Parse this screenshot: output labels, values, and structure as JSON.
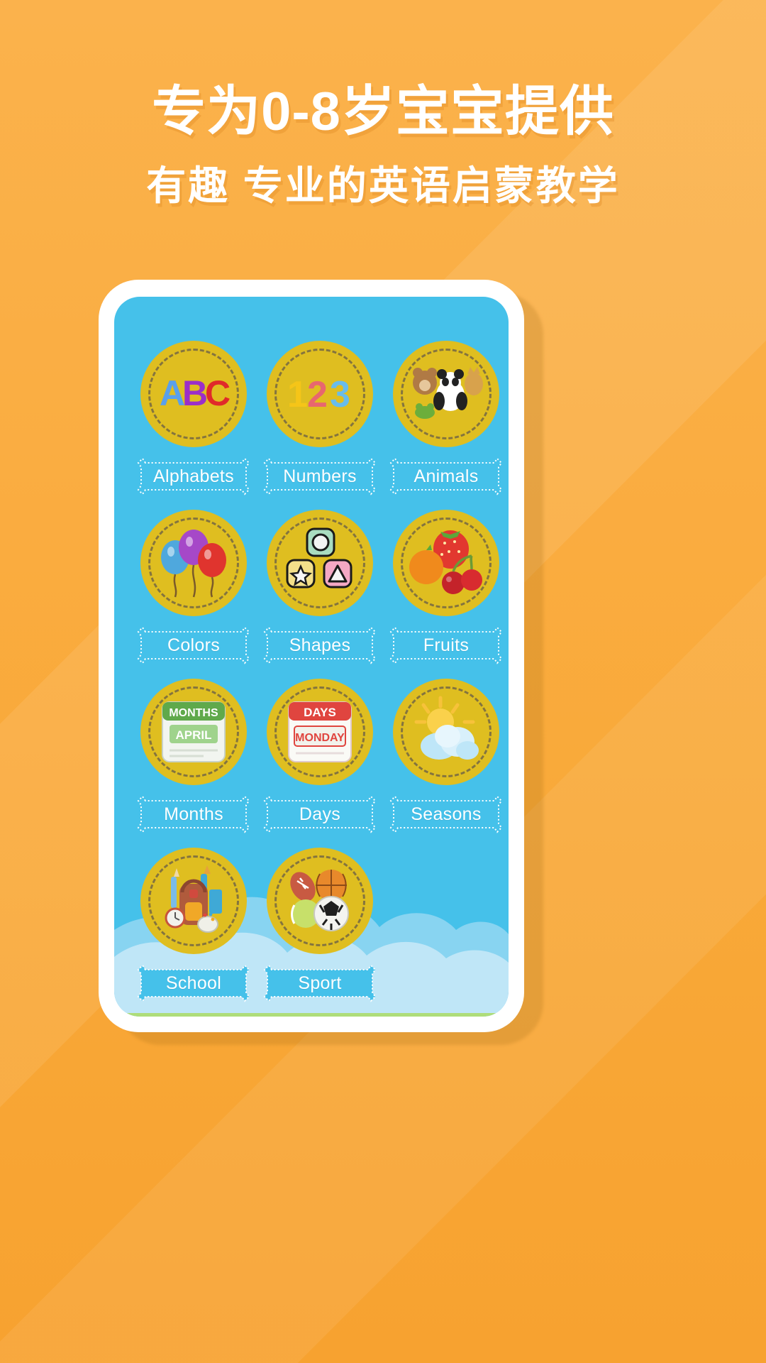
{
  "header": {
    "headline_main": "专为0-8岁宝宝提供",
    "headline_sub": "有趣  专业的英语启蒙教学"
  },
  "colors": {
    "background_orange": "#F9AE42",
    "background_orange_light": "#FBB24C",
    "screen_blue": "#45C1EA",
    "cloud_blue_light": "#BFE6F7",
    "cloud_blue_mid": "#9FDAF3",
    "disc_yellow": "#DFBE20",
    "disc_dash": "#6E6246",
    "label_white": "#FFFFFF",
    "phone_frame_white": "#FFFFFF",
    "green_strip": "#AEDD7A"
  },
  "grid": {
    "items": [
      {
        "label": "Alphabets",
        "icon": "abc-letters-icon",
        "banner": "outline"
      },
      {
        "label": "Numbers",
        "icon": "123-numbers-icon",
        "banner": "outline"
      },
      {
        "label": "Animals",
        "icon": "animals-icon",
        "banner": "outline"
      },
      {
        "label": "Colors",
        "icon": "balloons-icon",
        "banner": "outline"
      },
      {
        "label": "Shapes",
        "icon": "shape-blocks-icon",
        "banner": "outline"
      },
      {
        "label": "Fruits",
        "icon": "fruits-icon",
        "banner": "outline"
      },
      {
        "label": "Months",
        "icon": "calendar-month-icon",
        "banner": "outline"
      },
      {
        "label": "Days",
        "icon": "calendar-day-icon",
        "banner": "outline"
      },
      {
        "label": "Seasons",
        "icon": "sun-cloud-icon",
        "banner": "outline"
      },
      {
        "label": "School",
        "icon": "backpack-icon",
        "banner": "solid"
      },
      {
        "label": "Sport",
        "icon": "sports-balls-icon",
        "banner": "solid"
      }
    ]
  }
}
